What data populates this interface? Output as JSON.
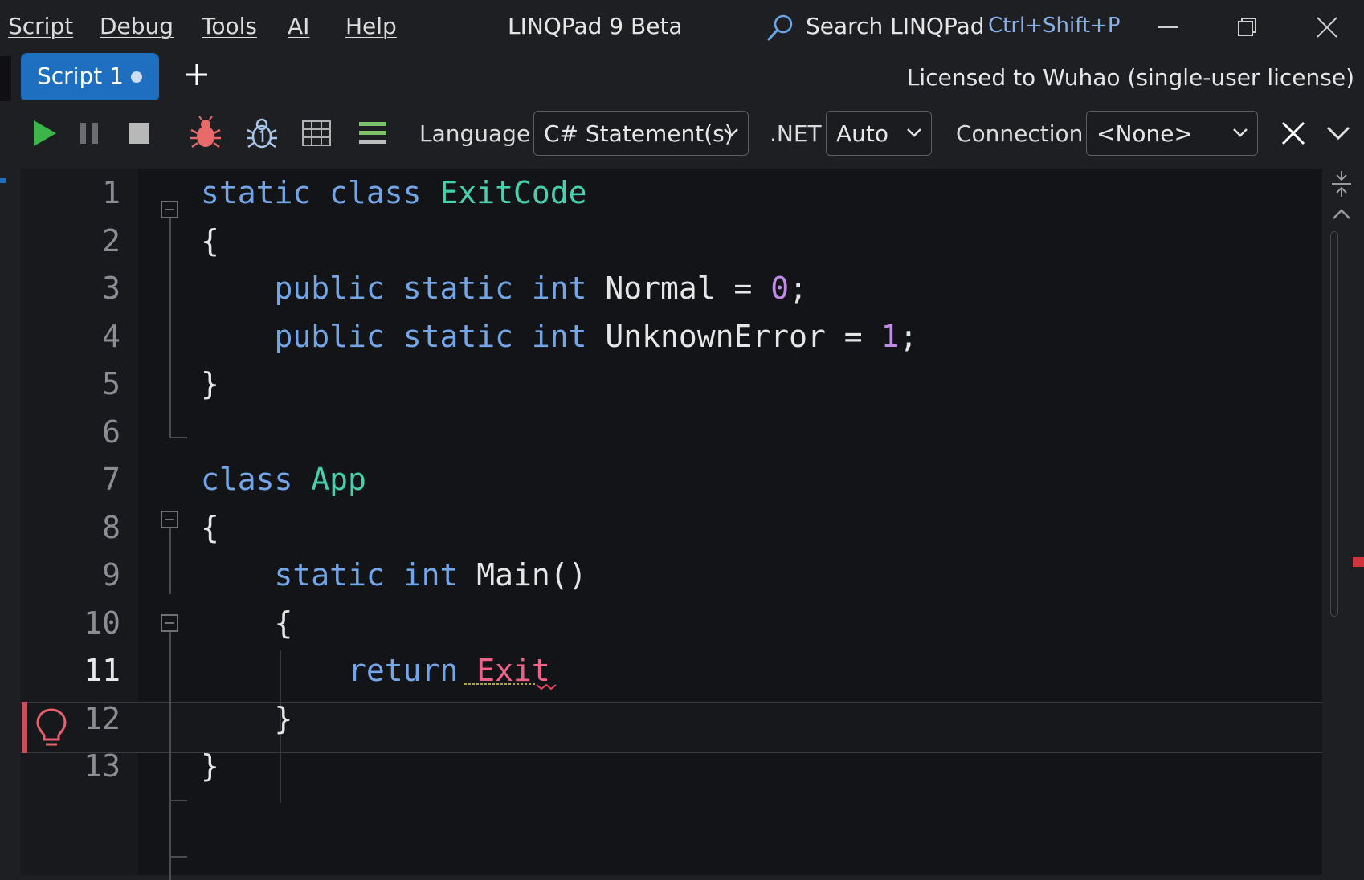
{
  "menu": {
    "items": [
      {
        "label": "Script"
      },
      {
        "label": "Debug"
      },
      {
        "label": "Tools"
      },
      {
        "label": "AI"
      },
      {
        "label": "Help"
      }
    ]
  },
  "window": {
    "title": "LINQPad 9 Beta"
  },
  "search": {
    "label": "Search LINQPad",
    "shortcut": "Ctrl+Shift+P"
  },
  "tabs": {
    "active_label": "Script 1",
    "license": "Licensed to Wuhao (single-user license)"
  },
  "toolbar": {
    "language_label": "Language",
    "language_value": "C# Statement(s)",
    "dotnet_label": ".NET",
    "dotnet_value": "Auto",
    "connection_label": "Connection",
    "connection_value": "<None>"
  },
  "editor": {
    "line_numbers": [
      "1",
      "2",
      "3",
      "4",
      "5",
      "6",
      "7",
      "8",
      "9",
      "10",
      "11",
      "12",
      "13"
    ],
    "current_line": "11",
    "code": {
      "l1_kw1": "static",
      "l1_kw2": "class",
      "l1_type": "ExitCode",
      "l2": "{",
      "l3_kw1": "public",
      "l3_kw2": "static",
      "l3_kw3": "int",
      "l3_name": "Normal = ",
      "l3_num": "0",
      "l3_end": ";",
      "l4_kw1": "public",
      "l4_kw2": "static",
      "l4_kw3": "int",
      "l4_name": "UnknownError = ",
      "l4_num": "1",
      "l4_end": ";",
      "l5": "}",
      "l7_kw": "class",
      "l7_type": "App",
      "l8": "{",
      "l9_kw1": "static",
      "l9_kw2": "int",
      "l9_name": "Main()",
      "l10": "{",
      "l11_kw": "return",
      "l11_err": "Exit",
      "l12": "}",
      "l13": "}"
    }
  },
  "colors": {
    "keyword": "#73a6e8",
    "type": "#45d1ad",
    "number": "#c18be8",
    "error": "#f06287",
    "accent": "#1f6fc1"
  }
}
